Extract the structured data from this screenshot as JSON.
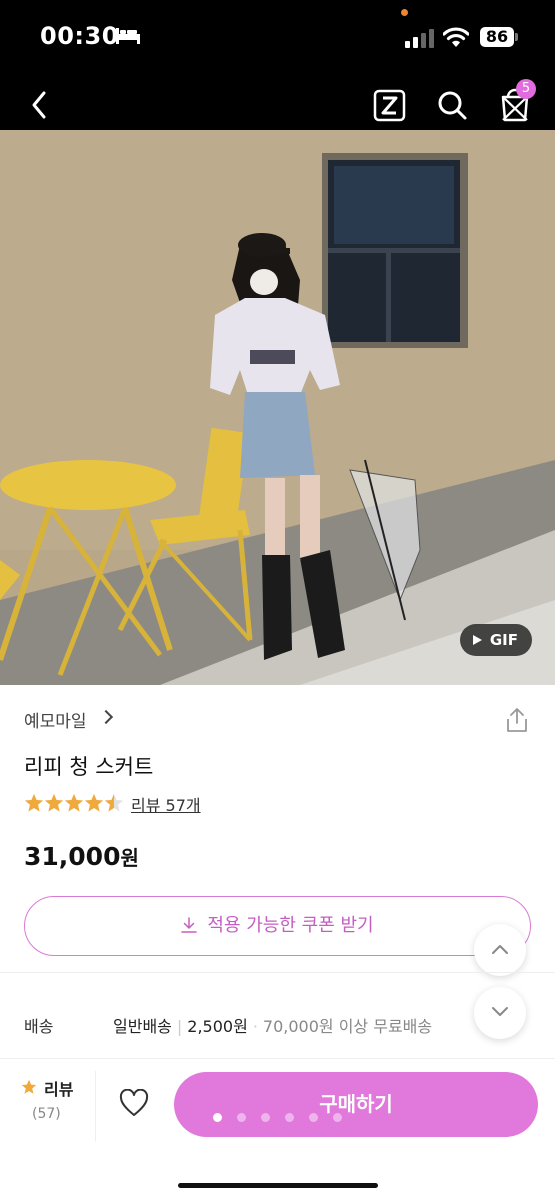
{
  "status_bar": {
    "time": "00:30",
    "battery": "86"
  },
  "nav": {
    "cart_count": "5",
    "icons": [
      "back-icon",
      "z-logo-icon",
      "search-icon",
      "cart-icon"
    ]
  },
  "gallery": {
    "gif_label": "GIF",
    "slide_count": 6,
    "active_slide": 1
  },
  "product": {
    "store": "예모마일",
    "title": "리피 청 스커트",
    "rating": 4.5,
    "review_link": "리뷰 57개",
    "price": "31,000",
    "price_unit": "원",
    "coupon_label": "적용 가능한 쿠폰 받기"
  },
  "shipping": {
    "label": "배송",
    "type": "일반배송",
    "fee": "2,500원",
    "free_condition": "70,000원 이상 무료배송"
  },
  "bottom_bar": {
    "review_label": "리뷰",
    "review_count": "(57)",
    "buy_label": "구매하기"
  },
  "colors": {
    "accent": "#e178dc",
    "coupon_text": "#c55ec2",
    "star": "#f0a93b"
  }
}
